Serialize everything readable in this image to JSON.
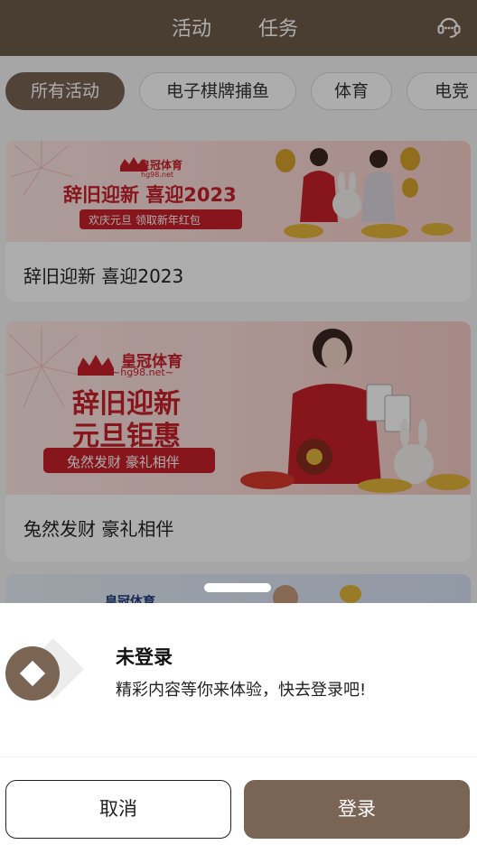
{
  "header": {
    "tabs": [
      {
        "label": "活动"
      },
      {
        "label": "任务"
      }
    ],
    "support_icon": "headset-icon"
  },
  "filters": {
    "chips": [
      {
        "label": "所有活动",
        "active": true
      },
      {
        "label": "电子棋牌捕鱼",
        "active": false
      },
      {
        "label": "体育",
        "active": false
      },
      {
        "label": "电竞",
        "active": false
      }
    ]
  },
  "cards": [
    {
      "title": "辞旧迎新 喜迎2023",
      "banner": {
        "brand": "皇冠体育",
        "domain": "hg98.net",
        "headline": "辞旧迎新 喜迎2023",
        "ribbon": "欢庆元旦 领取新年红包"
      }
    },
    {
      "title": "兔然发财 豪礼相伴",
      "banner": {
        "brand": "皇冠体育",
        "domain": "~hg98.net~",
        "headline_line1": "辞旧迎新",
        "headline_line2": "元旦钜惠",
        "ribbon": "兔然发财 豪礼相伴"
      }
    },
    {
      "title": "",
      "banner": {
        "brand": "皇冠体育"
      }
    }
  ],
  "login_sheet": {
    "title": "未登录",
    "message": "精彩内容等你来体验，快去登录吧!",
    "cancel_label": "取消",
    "login_label": "登录"
  },
  "colors": {
    "brand_brown": "#7a6454",
    "header_bg": "#6e5a4b",
    "banner_red": "#c8202a",
    "banner_pink": "#fbe3e1"
  }
}
